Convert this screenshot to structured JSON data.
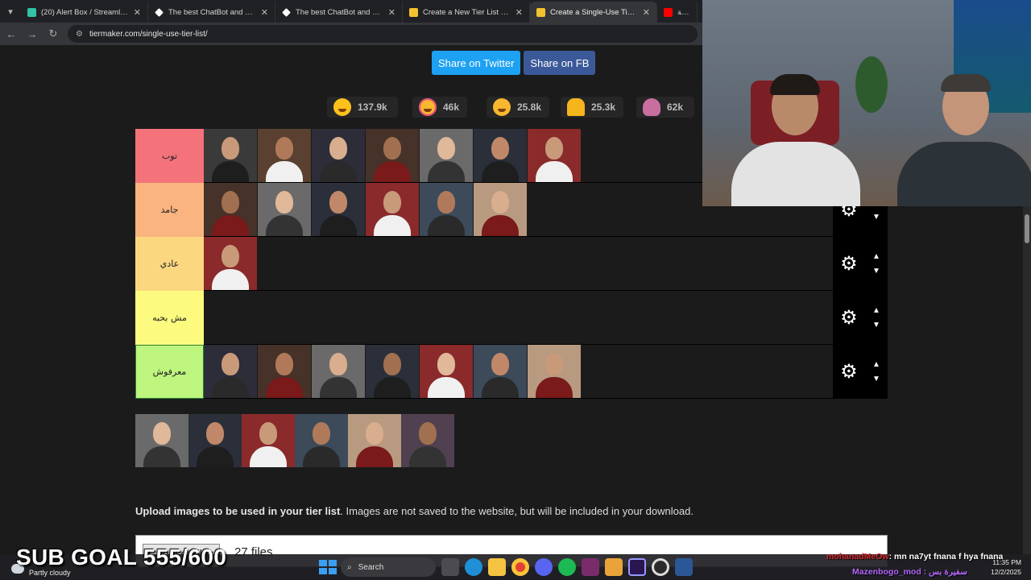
{
  "browser": {
    "tabs": [
      {
        "title": "(20) Alert Box / Streamlabs",
        "icon_color": "#31c3a2",
        "active": false
      },
      {
        "title": "The best ChatBot and Widgets",
        "icon_color": "#ffffff",
        "active": false
      },
      {
        "title": "The best ChatBot and Widgets",
        "icon_color": "#ffffff",
        "active": false
      },
      {
        "title": "Create a New Tier List - TierMa",
        "icon_color": "#f2c230",
        "active": false
      },
      {
        "title": "Create a Single-Use Tier List (P",
        "icon_color": "#f2c230",
        "active": true
      },
      {
        "title": "كلمة",
        "icon_color": "#ff0000",
        "active": false
      }
    ],
    "close_glyph": "✕",
    "url": "tiermaker.com/single-use-tier-list/"
  },
  "share": {
    "twitter_label": "Share on Twitter",
    "fb_label": "Share on FB"
  },
  "reactions": [
    {
      "emoji": "grin",
      "count": "137.9k"
    },
    {
      "emoji": "heart-eyes",
      "count": "46k"
    },
    {
      "emoji": "laughing",
      "count": "25.8k"
    },
    {
      "emoji": "raised-hands",
      "count": "25.3k"
    },
    {
      "emoji": "poop",
      "count": "62k"
    }
  ],
  "tiers": [
    {
      "label": "توب",
      "color": "#f4737b",
      "items": 7
    },
    {
      "label": "جامد",
      "color": "#f9b47f",
      "items": 6
    },
    {
      "label": "عادي",
      "color": "#fbd880",
      "items": 1
    },
    {
      "label": "مش بحبه",
      "color": "#fdfb7f",
      "items": 0
    },
    {
      "label": "معرفوش",
      "color": "#bef57f",
      "items": 7
    }
  ],
  "pool": {
    "items": 6
  },
  "upload": {
    "bold": "Upload images to be used in your tier list",
    "rest": ". Images are not saved to the website, but will be included in your download.",
    "button": "Choose Files",
    "count": "27 files"
  },
  "overlay": {
    "sub_goal": "SUB GOAL 555/600",
    "chat_user": "mohanadMeOw",
    "chat_text": ": mn na7yt fnana f hya fnana",
    "tray_user": "Mazenbogo_mod : سفيرة بس"
  },
  "taskbar": {
    "weather": "Partly cloudy",
    "search": "Search",
    "time": "11:35 PM",
    "date": "12/2/2025"
  },
  "colors": {
    "twitter": "#1da1f2",
    "fb": "#3b5998",
    "page_bg": "#1b1b1b"
  }
}
